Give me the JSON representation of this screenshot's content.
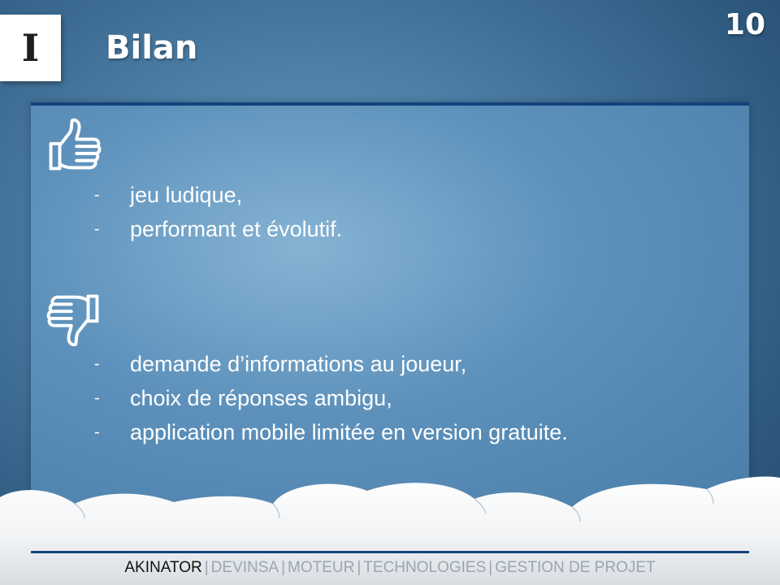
{
  "slide": {
    "section_badge": "I",
    "title": "Bilan",
    "number": "10"
  },
  "icons": {
    "pro": "thumbs-up-icon",
    "con": "thumbs-down-icon"
  },
  "pros": [
    "jeu ludique,",
    "performant et évolutif."
  ],
  "cons": [
    "demande d’informations au joueur,",
    "choix de réponses ambigu,",
    "application mobile limitée en version gratuite."
  ],
  "footer": {
    "items": [
      "AKINATOR",
      "DEVINSA",
      "MOTEUR",
      "TECHNOLOGIES",
      "GESTION DE PROJET"
    ],
    "separator": "|",
    "current_index": 0
  },
  "colors": {
    "accent": "#14427c",
    "footer_active": "#111111",
    "footer_inactive": "#9aa6b2"
  }
}
